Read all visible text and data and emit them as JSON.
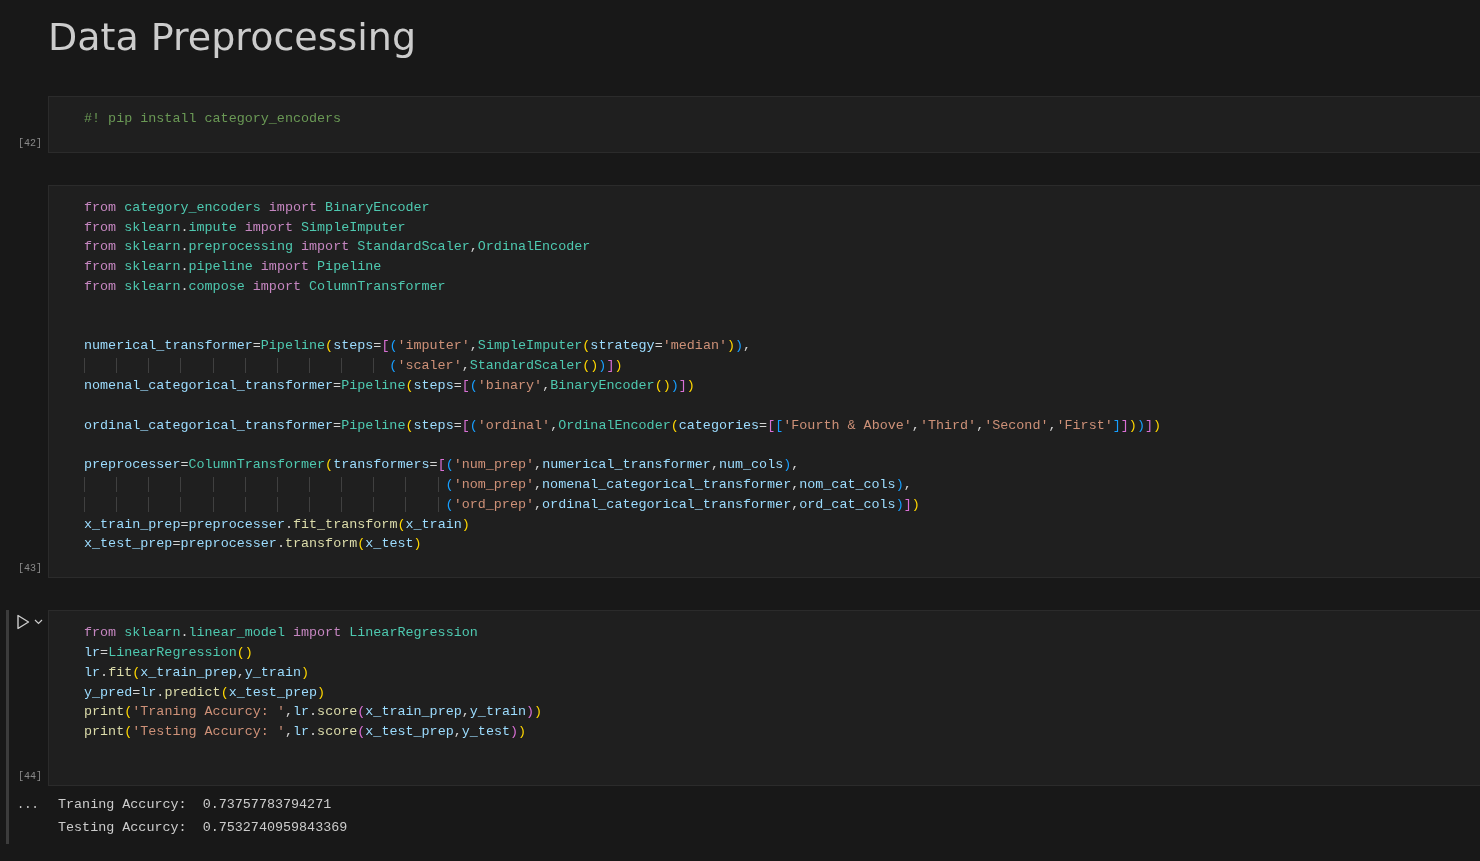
{
  "title": "Data Preprocessing",
  "cells": [
    {
      "selected": false,
      "execution_count": "[42]",
      "lines": [
        {
          "tokens": [
            {
              "kind": "comment",
              "text": "#! pip install category_encoders"
            }
          ]
        }
      ]
    },
    {
      "selected": false,
      "execution_count": "[43]",
      "lines": [
        {
          "tokens": [
            {
              "kind": "kw",
              "text": "from "
            },
            {
              "kind": "cls",
              "text": "category_encoders"
            },
            {
              "kind": "kw",
              "text": " import "
            },
            {
              "kind": "cls",
              "text": "BinaryEncoder"
            }
          ]
        },
        {
          "tokens": [
            {
              "kind": "kw",
              "text": "from "
            },
            {
              "kind": "cls",
              "text": "sklearn"
            },
            {
              "kind": "op",
              "text": "."
            },
            {
              "kind": "cls",
              "text": "impute"
            },
            {
              "kind": "kw",
              "text": " import "
            },
            {
              "kind": "cls",
              "text": "SimpleImputer"
            }
          ]
        },
        {
          "tokens": [
            {
              "kind": "kw",
              "text": "from "
            },
            {
              "kind": "cls",
              "text": "sklearn"
            },
            {
              "kind": "op",
              "text": "."
            },
            {
              "kind": "cls",
              "text": "preprocessing"
            },
            {
              "kind": "kw",
              "text": " import "
            },
            {
              "kind": "cls",
              "text": "StandardScaler"
            },
            {
              "kind": "op",
              "text": ","
            },
            {
              "kind": "cls",
              "text": "OrdinalEncoder"
            }
          ]
        },
        {
          "tokens": [
            {
              "kind": "kw",
              "text": "from "
            },
            {
              "kind": "cls",
              "text": "sklearn"
            },
            {
              "kind": "op",
              "text": "."
            },
            {
              "kind": "cls",
              "text": "pipeline"
            },
            {
              "kind": "kw",
              "text": " import "
            },
            {
              "kind": "cls",
              "text": "Pipeline"
            }
          ]
        },
        {
          "tokens": [
            {
              "kind": "kw",
              "text": "from "
            },
            {
              "kind": "cls",
              "text": "sklearn"
            },
            {
              "kind": "op",
              "text": "."
            },
            {
              "kind": "cls",
              "text": "compose"
            },
            {
              "kind": "kw",
              "text": " import "
            },
            {
              "kind": "cls",
              "text": "ColumnTransformer"
            }
          ]
        },
        {
          "blank": true
        },
        {
          "blank": true
        },
        {
          "tokens": [
            {
              "kind": "var",
              "text": "numerical_transformer"
            },
            {
              "kind": "op",
              "text": "="
            },
            {
              "kind": "cls",
              "text": "Pipeline"
            },
            {
              "kind": "b1",
              "text": "("
            },
            {
              "kind": "var",
              "text": "steps"
            },
            {
              "kind": "op",
              "text": "="
            },
            {
              "kind": "b2",
              "text": "["
            },
            {
              "kind": "b3",
              "text": "("
            },
            {
              "kind": "str",
              "text": "'imputer'"
            },
            {
              "kind": "op",
              "text": ","
            },
            {
              "kind": "cls",
              "text": "SimpleImputer"
            },
            {
              "kind": "b1",
              "text": "("
            },
            {
              "kind": "var",
              "text": "strategy"
            },
            {
              "kind": "op",
              "text": "="
            },
            {
              "kind": "str",
              "text": "'median'"
            },
            {
              "kind": "b1",
              "text": ")"
            },
            {
              "kind": "b3",
              "text": ")"
            },
            {
              "kind": "op",
              "text": ","
            }
          ]
        },
        {
          "tokens": [
            {
              "kind": "b3",
              "text": "                                      ("
            },
            {
              "kind": "str",
              "text": "'scaler'"
            },
            {
              "kind": "op",
              "text": ","
            },
            {
              "kind": "cls",
              "text": "StandardScaler"
            },
            {
              "kind": "b1",
              "text": "()"
            },
            {
              "kind": "b3",
              "text": ")"
            },
            {
              "kind": "b2",
              "text": "]"
            },
            {
              "kind": "b1",
              "text": ")"
            }
          ]
        },
        {
          "tokens": [
            {
              "kind": "var",
              "text": "nomenal_categorical_transformer"
            },
            {
              "kind": "op",
              "text": "="
            },
            {
              "kind": "cls",
              "text": "Pipeline"
            },
            {
              "kind": "b1",
              "text": "("
            },
            {
              "kind": "var",
              "text": "steps"
            },
            {
              "kind": "op",
              "text": "="
            },
            {
              "kind": "b2",
              "text": "["
            },
            {
              "kind": "b3",
              "text": "("
            },
            {
              "kind": "str",
              "text": "'binary'"
            },
            {
              "kind": "op",
              "text": ","
            },
            {
              "kind": "cls",
              "text": "BinaryEncoder"
            },
            {
              "kind": "b1",
              "text": "()"
            },
            {
              "kind": "b3",
              "text": ")"
            },
            {
              "kind": "b2",
              "text": "]"
            },
            {
              "kind": "b1",
              "text": ")"
            }
          ]
        },
        {
          "blank": true
        },
        {
          "tokens": [
            {
              "kind": "var",
              "text": "ordinal_categorical_transformer"
            },
            {
              "kind": "op",
              "text": "="
            },
            {
              "kind": "cls",
              "text": "Pipeline"
            },
            {
              "kind": "b1",
              "text": "("
            },
            {
              "kind": "var",
              "text": "steps"
            },
            {
              "kind": "op",
              "text": "="
            },
            {
              "kind": "b2",
              "text": "["
            },
            {
              "kind": "b3",
              "text": "("
            },
            {
              "kind": "str",
              "text": "'ordinal'"
            },
            {
              "kind": "op",
              "text": ","
            },
            {
              "kind": "cls",
              "text": "OrdinalEncoder"
            },
            {
              "kind": "b1",
              "text": "("
            },
            {
              "kind": "var",
              "text": "categories"
            },
            {
              "kind": "op",
              "text": "="
            },
            {
              "kind": "b2",
              "text": "["
            },
            {
              "kind": "b3",
              "text": "["
            },
            {
              "kind": "str",
              "text": "'Fourth & Above'"
            },
            {
              "kind": "op",
              "text": ","
            },
            {
              "kind": "str",
              "text": "'Third'"
            },
            {
              "kind": "op",
              "text": ","
            },
            {
              "kind": "str",
              "text": "'Second'"
            },
            {
              "kind": "op",
              "text": ","
            },
            {
              "kind": "str",
              "text": "'First'"
            },
            {
              "kind": "b3",
              "text": "]"
            },
            {
              "kind": "b2",
              "text": "]"
            },
            {
              "kind": "b1",
              "text": ")"
            },
            {
              "kind": "b3",
              "text": ")"
            },
            {
              "kind": "b2",
              "text": "]"
            },
            {
              "kind": "b1",
              "text": ")"
            }
          ]
        },
        {
          "blank": true
        },
        {
          "tokens": [
            {
              "kind": "var",
              "text": "preprocesser"
            },
            {
              "kind": "op",
              "text": "="
            },
            {
              "kind": "cls",
              "text": "ColumnTransformer"
            },
            {
              "kind": "b1",
              "text": "("
            },
            {
              "kind": "var",
              "text": "transformers"
            },
            {
              "kind": "op",
              "text": "="
            },
            {
              "kind": "b2",
              "text": "["
            },
            {
              "kind": "b3",
              "text": "("
            },
            {
              "kind": "str",
              "text": "'num_prep'"
            },
            {
              "kind": "op",
              "text": ","
            },
            {
              "kind": "var",
              "text": "numerical_transformer"
            },
            {
              "kind": "op",
              "text": ","
            },
            {
              "kind": "var",
              "text": "num_cols"
            },
            {
              "kind": "b3",
              "text": ")"
            },
            {
              "kind": "op",
              "text": ","
            }
          ]
        },
        {
          "tokens": [
            {
              "kind": "b3",
              "text": "                                             ("
            },
            {
              "kind": "str",
              "text": "'nom_prep'"
            },
            {
              "kind": "op",
              "text": ","
            },
            {
              "kind": "var",
              "text": "nomenal_categorical_transformer"
            },
            {
              "kind": "op",
              "text": ","
            },
            {
              "kind": "var",
              "text": "nom_cat_cols"
            },
            {
              "kind": "b3",
              "text": ")"
            },
            {
              "kind": "op",
              "text": ","
            }
          ]
        },
        {
          "tokens": [
            {
              "kind": "b3",
              "text": "                                             ("
            },
            {
              "kind": "str",
              "text": "'ord_prep'"
            },
            {
              "kind": "op",
              "text": ","
            },
            {
              "kind": "var",
              "text": "ordinal_categorical_transformer"
            },
            {
              "kind": "op",
              "text": ","
            },
            {
              "kind": "var",
              "text": "ord_cat_cols"
            },
            {
              "kind": "b3",
              "text": ")"
            },
            {
              "kind": "b2",
              "text": "]"
            },
            {
              "kind": "b1",
              "text": ")"
            }
          ]
        },
        {
          "tokens": [
            {
              "kind": "var",
              "text": "x_train_prep"
            },
            {
              "kind": "op",
              "text": "="
            },
            {
              "kind": "var",
              "text": "preprocesser"
            },
            {
              "kind": "op",
              "text": "."
            },
            {
              "kind": "fn",
              "text": "fit_transform"
            },
            {
              "kind": "b1",
              "text": "("
            },
            {
              "kind": "var",
              "text": "x_train"
            },
            {
              "kind": "b1",
              "text": ")"
            }
          ]
        },
        {
          "tokens": [
            {
              "kind": "var",
              "text": "x_test_prep"
            },
            {
              "kind": "op",
              "text": "="
            },
            {
              "kind": "var",
              "text": "preprocesser"
            },
            {
              "kind": "op",
              "text": "."
            },
            {
              "kind": "fn",
              "text": "transform"
            },
            {
              "kind": "b1",
              "text": "("
            },
            {
              "kind": "var",
              "text": "x_test"
            },
            {
              "kind": "b1",
              "text": ")"
            }
          ]
        }
      ]
    },
    {
      "selected": true,
      "execution_count": "[44]",
      "lines": [
        {
          "tokens": [
            {
              "kind": "kw",
              "text": "from "
            },
            {
              "kind": "cls",
              "text": "sklearn"
            },
            {
              "kind": "op",
              "text": "."
            },
            {
              "kind": "cls",
              "text": "linear_model"
            },
            {
              "kind": "kw",
              "text": " import "
            },
            {
              "kind": "cls",
              "text": "LinearRegression"
            }
          ]
        },
        {
          "tokens": [
            {
              "kind": "var",
              "text": "lr"
            },
            {
              "kind": "op",
              "text": "="
            },
            {
              "kind": "cls",
              "text": "LinearRegression"
            },
            {
              "kind": "b1",
              "text": "()"
            }
          ]
        },
        {
          "tokens": [
            {
              "kind": "var",
              "text": "lr"
            },
            {
              "kind": "op",
              "text": "."
            },
            {
              "kind": "fn",
              "text": "fit"
            },
            {
              "kind": "b1",
              "text": "("
            },
            {
              "kind": "var",
              "text": "x_train_prep"
            },
            {
              "kind": "op",
              "text": ","
            },
            {
              "kind": "var",
              "text": "y_train"
            },
            {
              "kind": "b1",
              "text": ")"
            }
          ]
        },
        {
          "tokens": [
            {
              "kind": "var",
              "text": "y_pred"
            },
            {
              "kind": "op",
              "text": "="
            },
            {
              "kind": "var",
              "text": "lr"
            },
            {
              "kind": "op",
              "text": "."
            },
            {
              "kind": "fn",
              "text": "predict"
            },
            {
              "kind": "b1",
              "text": "("
            },
            {
              "kind": "var",
              "text": "x_test_prep"
            },
            {
              "kind": "b1",
              "text": ")"
            }
          ]
        },
        {
          "tokens": [
            {
              "kind": "fn",
              "text": "print"
            },
            {
              "kind": "b1",
              "text": "("
            },
            {
              "kind": "str",
              "text": "'Traning Accurcy: '"
            },
            {
              "kind": "op",
              "text": ","
            },
            {
              "kind": "var",
              "text": "lr"
            },
            {
              "kind": "op",
              "text": "."
            },
            {
              "kind": "fn",
              "text": "score"
            },
            {
              "kind": "b2",
              "text": "("
            },
            {
              "kind": "var",
              "text": "x_train_prep"
            },
            {
              "kind": "op",
              "text": ","
            },
            {
              "kind": "var",
              "text": "y_train"
            },
            {
              "kind": "b2",
              "text": ")"
            },
            {
              "kind": "b1",
              "text": ")"
            }
          ]
        },
        {
          "tokens": [
            {
              "kind": "fn",
              "text": "print"
            },
            {
              "kind": "b1",
              "text": "("
            },
            {
              "kind": "str",
              "text": "'Testing Accurcy: '"
            },
            {
              "kind": "op",
              "text": ","
            },
            {
              "kind": "var",
              "text": "lr"
            },
            {
              "kind": "op",
              "text": "."
            },
            {
              "kind": "fn",
              "text": "score"
            },
            {
              "kind": "b2",
              "text": "("
            },
            {
              "kind": "var",
              "text": "x_test_prep"
            },
            {
              "kind": "op",
              "text": ","
            },
            {
              "kind": "var",
              "text": "y_test"
            },
            {
              "kind": "b2",
              "text": ")"
            },
            {
              "kind": "b1",
              "text": ")"
            }
          ]
        },
        {
          "blank": true
        }
      ],
      "output": {
        "menu": "...",
        "lines": [
          "Traning Accurcy:  0.73757783794271",
          "Testing Accurcy:  0.7532740959843369"
        ]
      }
    }
  ]
}
